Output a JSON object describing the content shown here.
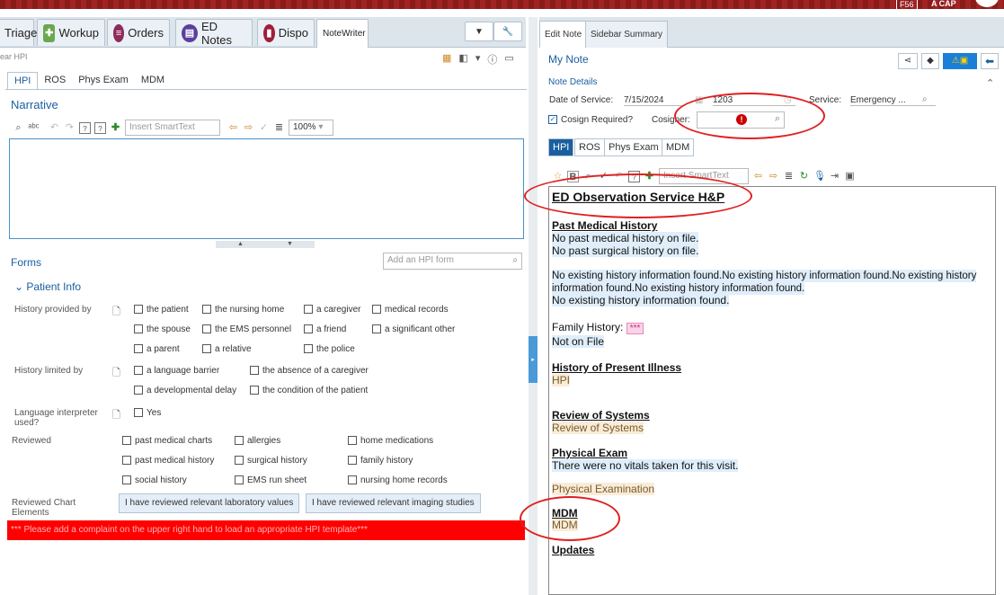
{
  "topbar": {
    "btn1": "F56",
    "btn2": "A CAP"
  },
  "activity_tabs": [
    {
      "label": "Triage",
      "icon": ""
    },
    {
      "label": "Workup",
      "icon": "workup-icon"
    },
    {
      "label": "Orders",
      "icon": "orders-icon"
    },
    {
      "label": "ED Notes",
      "icon": "ed-notes-icon"
    },
    {
      "label": "Dispo",
      "icon": "dispo-icon"
    },
    {
      "label": "NoteWriter",
      "icon": ""
    }
  ],
  "left": {
    "subtitle": "ear HPI",
    "subtabs": [
      "HPI",
      "ROS",
      "Phys Exam",
      "MDM"
    ],
    "narrative_title": "Narrative",
    "smarttext_placeholder": "Insert SmartText",
    "zoom": "100%",
    "forms_title": "Forms",
    "hpi_form_placeholder": "Add an HPI form",
    "patient_info": "Patient Info",
    "history_provided_by": "History provided by",
    "hp_options": [
      "the patient",
      "the nursing home",
      "a caregiver",
      "medical records",
      "the spouse",
      "the EMS personnel",
      "a friend",
      "a significant other",
      "a parent",
      "a relative",
      "the police"
    ],
    "history_limited_by": "History limited by",
    "hl_options": [
      "a language barrier",
      "the absence of a caregiver",
      "a developmental delay",
      "the condition of the patient"
    ],
    "language_interpreter": "Language interpreter used?",
    "li_option": "Yes",
    "reviewed": "Reviewed",
    "rev_options": [
      "past medical charts",
      "allergies",
      "home medications",
      "past medical history",
      "surgical history",
      "family history",
      "social history",
      "EMS run sheet",
      "nursing home records"
    ],
    "reviewed_chart": "Reviewed Chart Elements",
    "lab_btn": "I have reviewed relevant laboratory values",
    "img_btn": "I have reviewed relevant imaging studies",
    "warning": "*** Please add a complaint on the upper right hand to load an appropriate HPI template***"
  },
  "right": {
    "tabs": [
      "Edit Note",
      "Sidebar Summary"
    ],
    "my_note": "My Note",
    "note_details": "Note Details",
    "date_label": "Date of Service:",
    "date_value": "7/15/2024",
    "time_value": "1203",
    "service_label": "Service:",
    "service_value": "Emergency ...",
    "cosign_label": "Cosign Required?",
    "cosigner_label": "Cosigner:",
    "subtabs": [
      "HPI",
      "ROS",
      "Phys Exam",
      "MDM"
    ],
    "smarttext_placeholder": "Insert SmartText",
    "doc": {
      "title": "ED Observation Service H&P",
      "pmh": "Past Medical History",
      "pmh1": "No past medical history on file.",
      "pmh2": "No past surgical history on file.",
      "hist1": "No existing history information found.No existing history information found.No existing history",
      "hist2": "information found.No existing history information found.",
      "hist3": "No existing history information found.",
      "fam_label": "Family History:",
      "fam_stars": "***",
      "fam_value": "Not on File",
      "hpi_h": "History of Present Illness",
      "hpi_v": "HPI",
      "ros_h": "Review of Systems",
      "ros_v": "Review of Systems",
      "pe_h": "Physical Exam",
      "pe_1": "There were no vitals taken for this visit.",
      "pe_2": "Physical Examination",
      "mdm_h": "MDM",
      "mdm_v": "MDM",
      "upd_h": "Updates"
    }
  },
  "colors": {
    "accent": "#1a5fa0",
    "warning": "#ff0000",
    "annotation": "#e02020"
  }
}
